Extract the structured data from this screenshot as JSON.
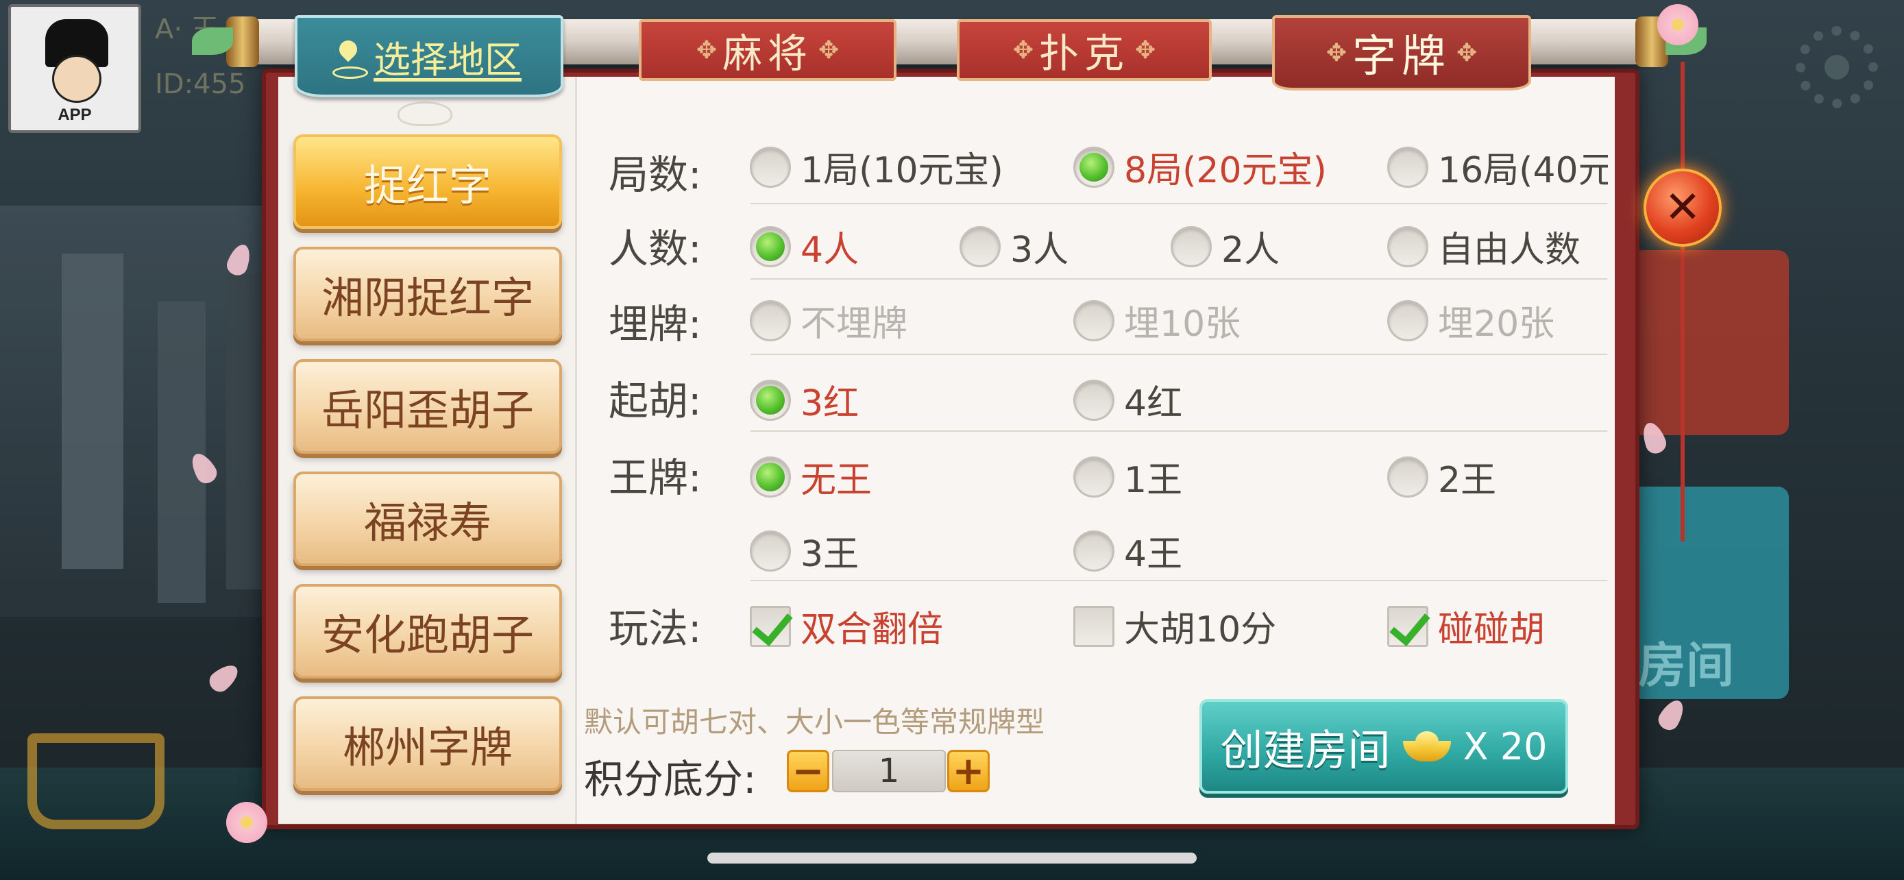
{
  "player": {
    "name": "A· 王",
    "id": "ID:455",
    "avatar_label": "APP"
  },
  "tabs": {
    "region": "选择地区",
    "mahjong": "麻将",
    "poker": "扑克",
    "zipai": "字牌"
  },
  "sidebar": {
    "items": [
      {
        "label": "捉红字",
        "active": true
      },
      {
        "label": "湘阴捉红字",
        "active": false
      },
      {
        "label": "岳阳歪胡子",
        "active": false
      },
      {
        "label": "福禄寿",
        "active": false
      },
      {
        "label": "安化跑胡子",
        "active": false
      },
      {
        "label": "郴州字牌",
        "active": false
      }
    ]
  },
  "options": {
    "rounds": {
      "label": "局数:",
      "choices": [
        "1局(10元宝)",
        "8局(20元宝)",
        "16局(40元"
      ],
      "selected": 1
    },
    "players": {
      "label": "人数:",
      "choices": [
        "4人",
        "3人",
        "2人",
        "自由人数"
      ],
      "selected": 0
    },
    "bury": {
      "label": "埋牌:",
      "choices": [
        "不埋牌",
        "埋10张",
        "埋20张"
      ],
      "selected": -1,
      "disabled": true
    },
    "qihu": {
      "label": "起胡:",
      "choices": [
        "3红",
        "4红"
      ],
      "selected": 0
    },
    "wang": {
      "label": "王牌:",
      "choices": [
        "无王",
        "1王",
        "2王",
        "3王",
        "4王"
      ],
      "selected": 0
    },
    "play": {
      "label": "玩法:",
      "choices": [
        "双合翻倍",
        "大胡10分",
        "碰碰胡"
      ],
      "checked": [
        true,
        false,
        true
      ]
    }
  },
  "footer": {
    "hint": "默认可胡七对、大小一色等常规牌型",
    "score_label": "积分底分:",
    "minus": "−",
    "score_value": "1",
    "plus": "+",
    "create_label": "创建房间",
    "create_cost": "X 20"
  },
  "close_label": "✕",
  "background": {
    "room_text": "房间"
  },
  "colors": {
    "selected_text": "#c9412f",
    "accent_teal": "#2fa7a2",
    "frame_red": "#8d2b2a"
  }
}
